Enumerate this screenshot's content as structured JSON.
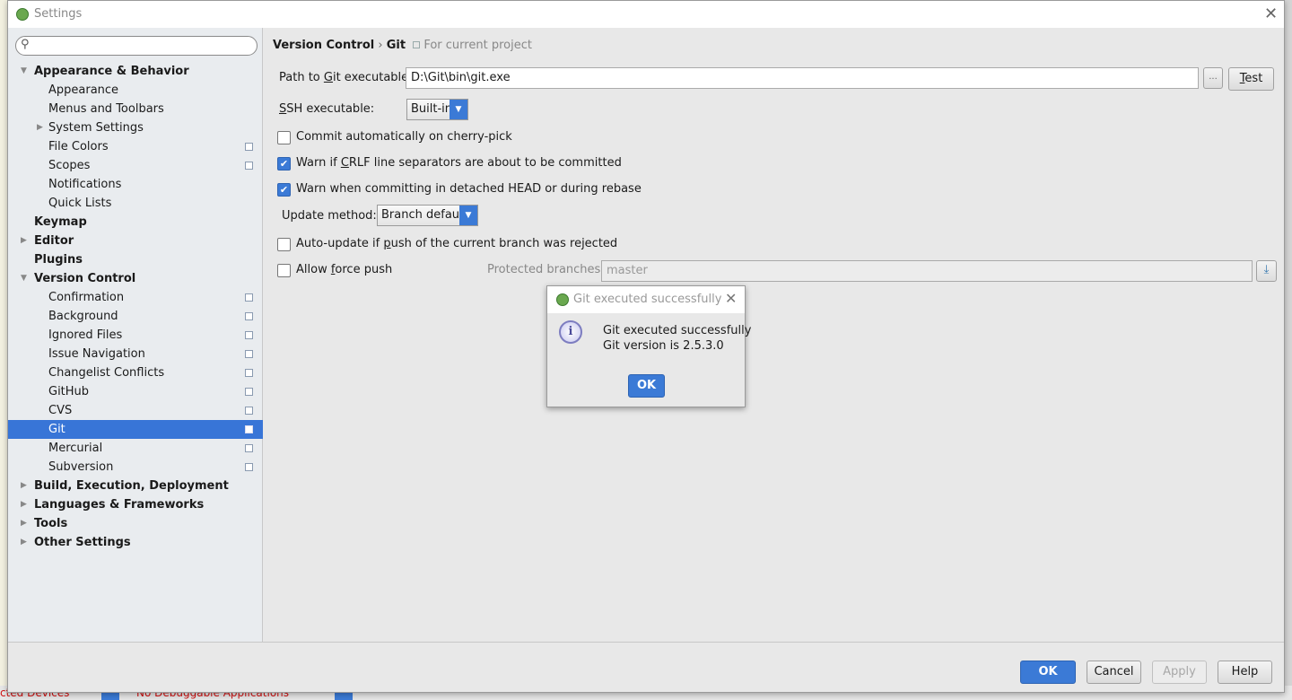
{
  "window": {
    "title": "Settings"
  },
  "search": {
    "placeholder": ""
  },
  "tree": [
    {
      "label": "Appearance & Behavior",
      "level": 0,
      "bold": true,
      "arrow": "expanded"
    },
    {
      "label": "Appearance",
      "level": 1
    },
    {
      "label": "Menus and Toolbars",
      "level": 1
    },
    {
      "label": "System Settings",
      "level": 1,
      "arrow": "collapsed"
    },
    {
      "label": "File Colors",
      "level": 1,
      "project": true
    },
    {
      "label": "Scopes",
      "level": 1,
      "project": true
    },
    {
      "label": "Notifications",
      "level": 1
    },
    {
      "label": "Quick Lists",
      "level": 1
    },
    {
      "label": "Keymap",
      "level": 0,
      "bold": true
    },
    {
      "label": "Editor",
      "level": 0,
      "bold": true,
      "arrow": "collapsed"
    },
    {
      "label": "Plugins",
      "level": 0,
      "bold": true
    },
    {
      "label": "Version Control",
      "level": 0,
      "bold": true,
      "arrow": "expanded"
    },
    {
      "label": "Confirmation",
      "level": 1,
      "project": true
    },
    {
      "label": "Background",
      "level": 1,
      "project": true
    },
    {
      "label": "Ignored Files",
      "level": 1,
      "project": true
    },
    {
      "label": "Issue Navigation",
      "level": 1,
      "project": true
    },
    {
      "label": "Changelist Conflicts",
      "level": 1,
      "project": true
    },
    {
      "label": "GitHub",
      "level": 1,
      "project": true
    },
    {
      "label": "CVS",
      "level": 1,
      "project": true
    },
    {
      "label": "Git",
      "level": 1,
      "project": true,
      "selected": true
    },
    {
      "label": "Mercurial",
      "level": 1,
      "project": true
    },
    {
      "label": "Subversion",
      "level": 1,
      "project": true
    },
    {
      "label": "Build, Execution, Deployment",
      "level": 0,
      "bold": true,
      "arrow": "collapsed"
    },
    {
      "label": "Languages & Frameworks",
      "level": 0,
      "bold": true,
      "arrow": "collapsed"
    },
    {
      "label": "Tools",
      "level": 0,
      "bold": true,
      "arrow": "collapsed"
    },
    {
      "label": "Other Settings",
      "level": 0,
      "bold": true,
      "arrow": "collapsed"
    }
  ],
  "breadcrumb": {
    "parent": "Version Control",
    "sep": "›",
    "current": "Git",
    "scope": "For current project"
  },
  "git": {
    "path_label_pre": "Path to ",
    "path_label_u": "G",
    "path_label_post": "it executable:",
    "path_value": "D:\\Git\\bin\\git.exe",
    "browse_label": "...",
    "test_u": "T",
    "test_rest": "est",
    "ssh_label_u": "S",
    "ssh_label_post": "SH executable:",
    "ssh_value": "Built-in",
    "cherry_pick": {
      "label": "Commit automatically on cherry-pick",
      "checked": false
    },
    "crlf": {
      "pre": "Warn if ",
      "u": "C",
      "post": "RLF line separators are about to be committed",
      "checked": true
    },
    "detached": {
      "label": "Warn when committing in detached HEAD or during rebase",
      "checked": true
    },
    "update_method_label": "Update method:",
    "update_method_value": "Branch default",
    "auto_update": {
      "pre": "Auto-update if ",
      "u": "p",
      "post": "ush of the current branch was rejected",
      "checked": false
    },
    "force_push": {
      "pre": "Allow ",
      "u": "f",
      "post": "orce push",
      "checked": false
    },
    "protected_label": "Protected branches:",
    "protected_value": "master"
  },
  "popup": {
    "title": "Git executed successfully",
    "line1": "Git executed successfully",
    "line2": "Git version is 2.5.3.0",
    "ok": "OK"
  },
  "buttons": {
    "ok": "OK",
    "cancel": "Cancel",
    "apply": "Apply",
    "help": "Help"
  },
  "statusbar": {
    "devices": "cted Devices",
    "apps": "No Debuggable Applications"
  },
  "colors": {
    "accent": "#3b7ad6",
    "sidebar": "#e9ecef",
    "panel": "#e8e8e8"
  }
}
